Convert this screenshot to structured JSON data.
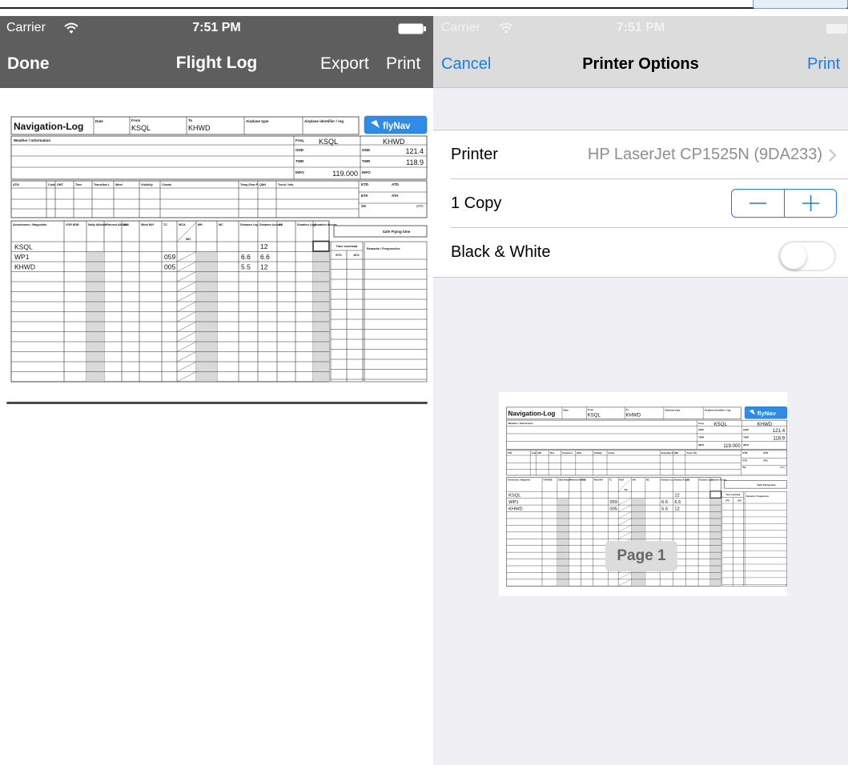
{
  "left": {
    "status": {
      "carrier": "Carrier",
      "time": "7:51 PM"
    },
    "nav": {
      "done": "Done",
      "title": "Flight Log",
      "export": "Export",
      "print": "Print"
    }
  },
  "right": {
    "status": {
      "carrier": "Carrier",
      "time": "7:51 PM"
    },
    "nav": {
      "cancel": "Cancel",
      "title": "Printer Options",
      "print": "Print"
    },
    "printer": {
      "label": "Printer",
      "value": "HP LaserJet CP1525N (9DA233)"
    },
    "copies": {
      "label": "1 Copy"
    },
    "bw": {
      "label": "Black & White",
      "on": false
    },
    "page_badge": "Page 1"
  },
  "navlog": {
    "title": "Navigation-Log",
    "date_label": "Date",
    "from_label": "From",
    "from": "KSQL",
    "to_label": "To",
    "to": "KHWD",
    "airplane_type_label": "Airplane type",
    "airplane_id_label": "Airplane identifier / reg",
    "brand": "flyNav",
    "weather_label": "Weather / Information",
    "freq_label": "Freq.",
    "freq_from": "KSQL",
    "freq_to": "KHWD",
    "gnd_label": "GND",
    "twr_label": "TWR",
    "info_label": "INFO",
    "gnd_to": "121.4",
    "twr_to": "118.9",
    "info_from": "119.000",
    "atis_headers": [
      "ATIS",
      "Code",
      "GMT",
      "Time",
      "Transition L",
      "Wind",
      "Visibility",
      "Clouds",
      "Temp./Dew P",
      "QNH",
      "Trend / Info"
    ],
    "etd_label": "ETD",
    "atd_label": "ATD",
    "eta_label": "ETA",
    "ata_label": "ATA",
    "ss_label": "SS",
    "utc_label": "UTC",
    "safe_flying_label": "Safe Flying time",
    "wp_headers": [
      "Aerodromes / Waypoints",
      "VOR NDB",
      "Safty Altitude",
      "Planned Altitude",
      "TAS",
      "Wind W/V",
      "TC",
      "WCA",
      "MH",
      "MC",
      "Distance Leg",
      "Distance Accum.",
      "GS",
      "Duration Legs",
      "Duration Accum."
    ],
    "wh_label": "WH",
    "time_overhead_label": "Time overhead",
    "eto_label": "ETO",
    "ato_label": "ATO",
    "remarks_label": "Remarks / Frequencies",
    "accum_start": "12",
    "waypoints": [
      {
        "name": "KSQL",
        "tc": "",
        "dist": "",
        "accum": ""
      },
      {
        "name": "WP1",
        "tc": "059",
        "dist": "6.6",
        "accum": "6.6"
      },
      {
        "name": "KHWD",
        "tc": "005",
        "dist": "5.5",
        "accum": "12"
      }
    ]
  }
}
